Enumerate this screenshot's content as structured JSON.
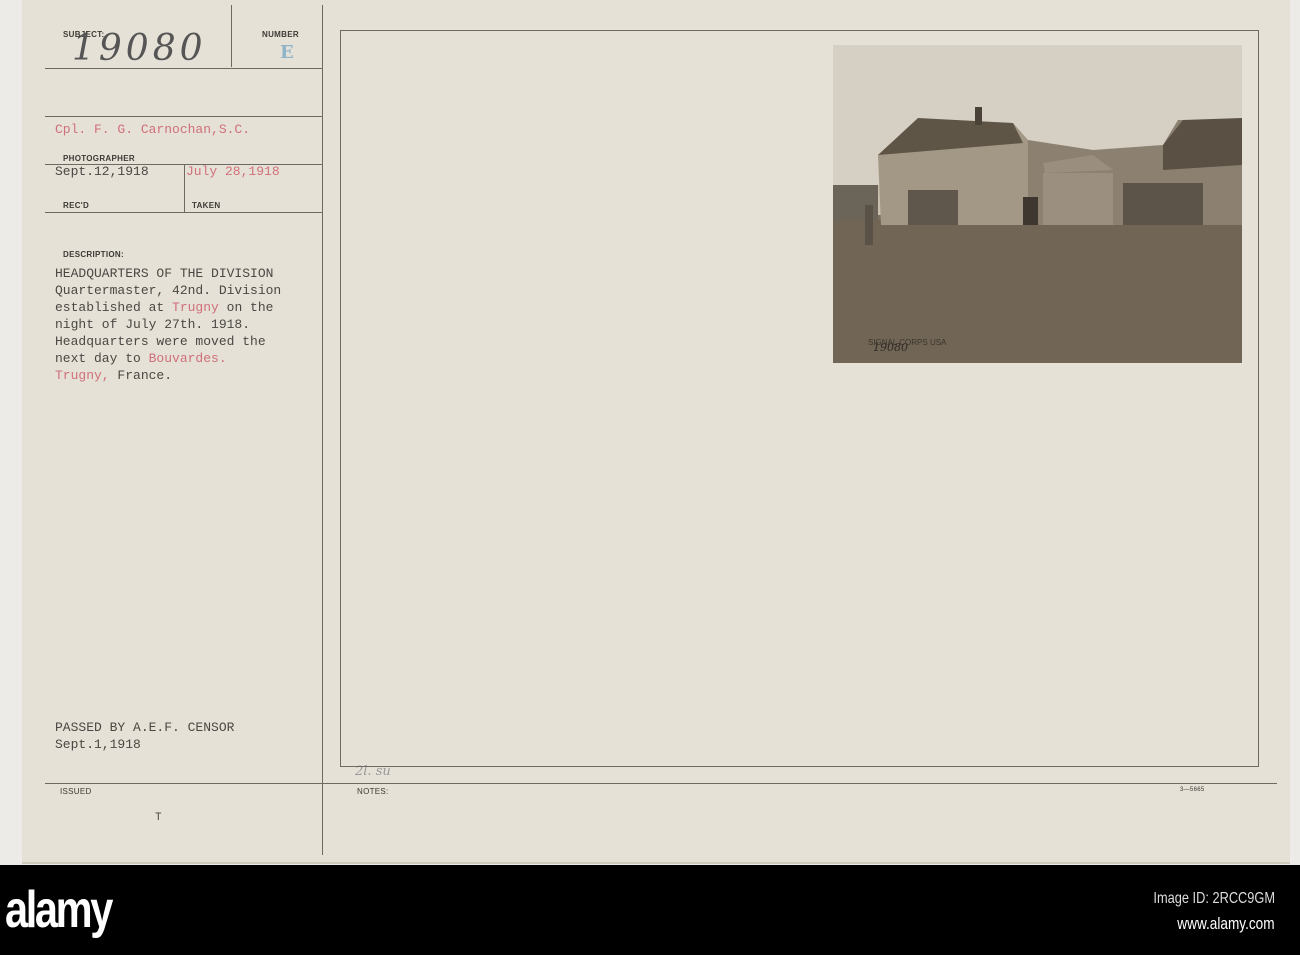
{
  "card": {
    "subject_label": "SUBJECT:",
    "subject_value": "19080",
    "number_label": "NUMBER",
    "number_value": "E",
    "photographer": "Cpl. F. G. Carnochan,S.C.",
    "photographer_label": "PHOTOGRAPHER",
    "received": "Sept.12,1918",
    "received_label": "REC'D",
    "taken": "July 28,1918",
    "taken_label": "TAKEN",
    "description_label": "DESCRIPTION:",
    "description_lines": [
      "HEADQUARTERS OF THE DIVISION",
      "Quartermaster, 42nd. Division",
      "established at ",
      "Trugny",
      " on the",
      "night of July 27th. 1918.",
      "Headquarters were moved the",
      "next day to ",
      "Bouvardes.",
      "Trugny,",
      " France."
    ],
    "censor_line1": "PASSED BY A.E.F. CENSOR",
    "censor_line2": "Sept.1,1918",
    "issued_label": "ISSUED",
    "issued_value": "T",
    "notes_label": "NOTES:",
    "notes_handwriting": "2l. su",
    "form_number": "3—5665"
  },
  "photo": {
    "stamp_text": "SIGNAL CORPS USA",
    "stamp_number": "19080"
  },
  "footer": {
    "logo": "alamy",
    "image_id": "Image ID: 2RCC9GM",
    "url": "www.alamy.com"
  }
}
